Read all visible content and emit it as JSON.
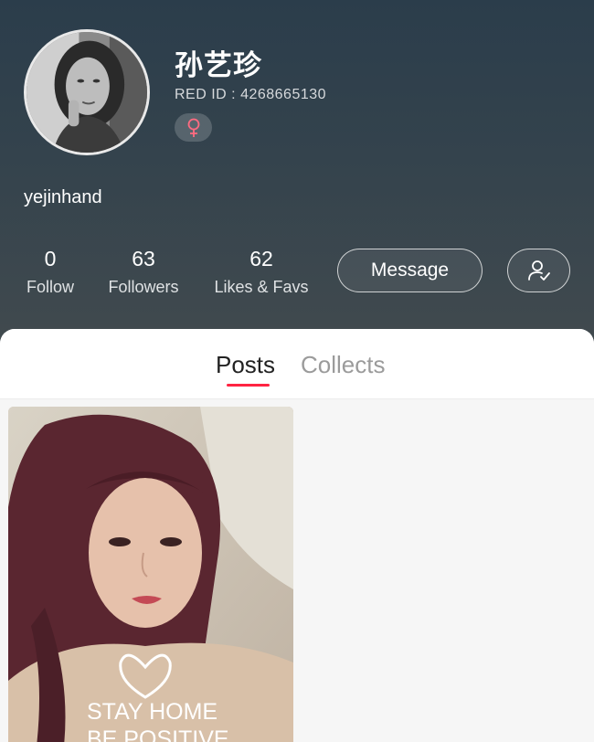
{
  "profile": {
    "name": "孙艺珍",
    "red_id": "RED ID : 4268665130",
    "gender_icon": "female-symbol-icon",
    "description": "yejinhand"
  },
  "stats": [
    {
      "value": "0",
      "label": "Follow"
    },
    {
      "value": "63",
      "label": "Followers"
    },
    {
      "value": "62",
      "label": "Likes & Favs"
    }
  ],
  "actions": {
    "message_label": "Message",
    "follow_icon": "user-check-icon"
  },
  "tabs": {
    "posts": "Posts",
    "collects": "Collects",
    "active": "Posts"
  },
  "post": {
    "shirt_text_1": "STAY HOME",
    "shirt_text_2": "BE POSITIVE"
  },
  "colors": {
    "accent": "#ff2442",
    "header_top": "#2b3d4b",
    "header_bottom": "#414a4e"
  }
}
